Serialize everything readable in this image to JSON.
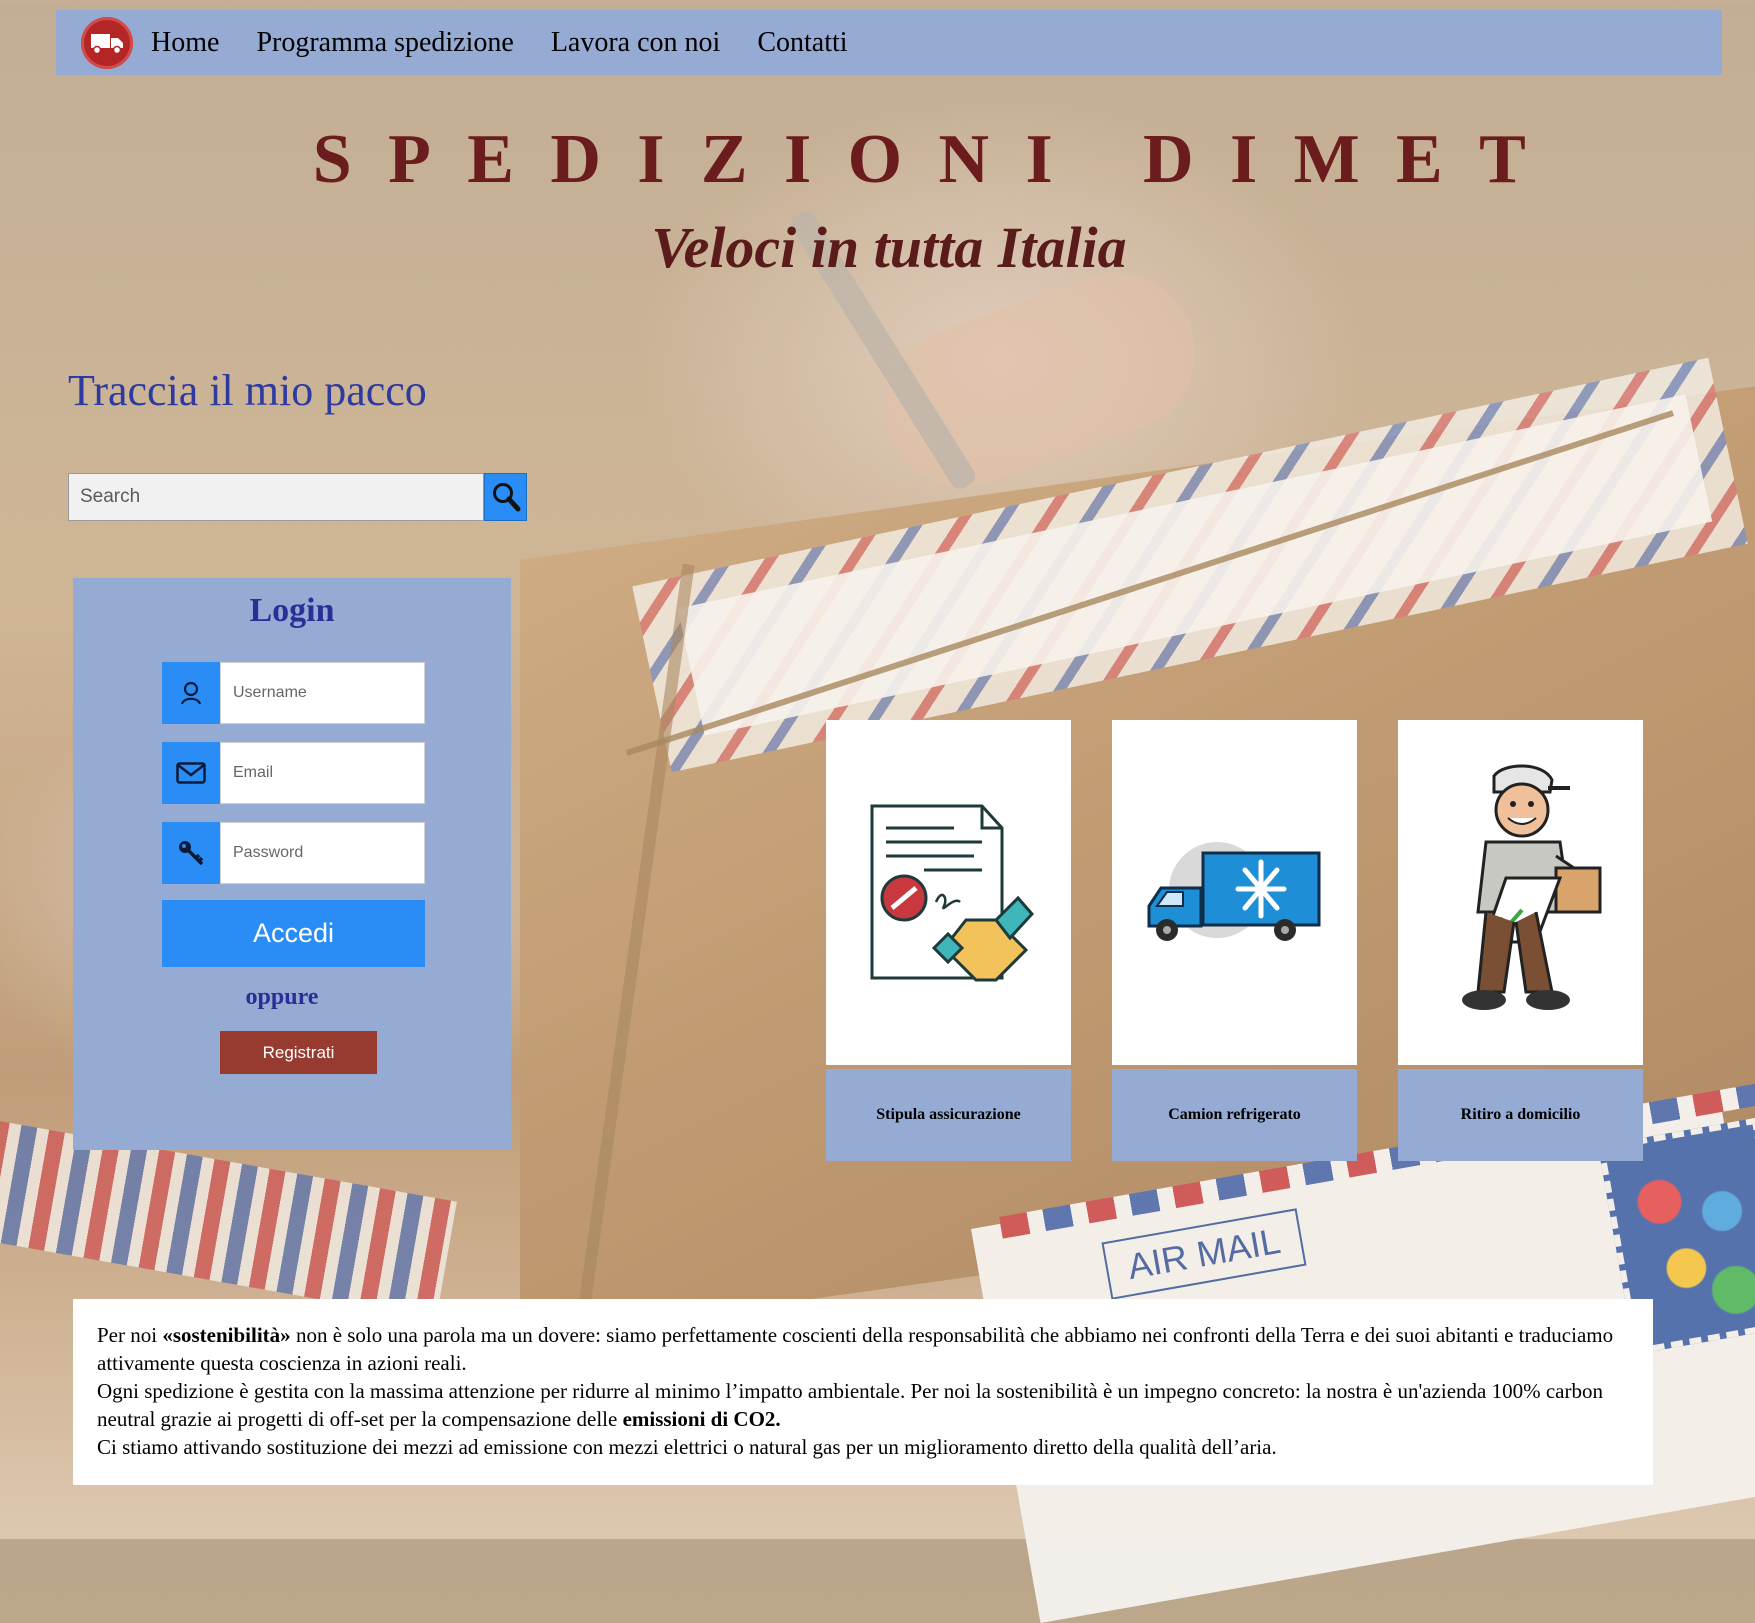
{
  "nav": {
    "links": [
      "Home",
      "Programma spedizione",
      "Lavora con noi",
      "Contatti"
    ]
  },
  "hero": {
    "title": "SPEDIZIONI DIMET",
    "tagline": "Veloci in tutta Italia"
  },
  "tracking": {
    "title": "Traccia il mio pacco",
    "search_placeholder": "Search"
  },
  "login": {
    "title": "Login",
    "username_placeholder": "Username",
    "email_placeholder": "Email",
    "password_placeholder": "Password",
    "submit_label": "Accedi",
    "or_label": "oppure",
    "register_label": "Registrati"
  },
  "services": [
    {
      "label": "Stipula assicurazione",
      "icon": "contract-handshake-icon"
    },
    {
      "label": "Camion refrigerato",
      "icon": "refrigerated-truck-icon"
    },
    {
      "label": "Ritiro a domicilio",
      "icon": "delivery-man-icon"
    }
  ],
  "background": {
    "airmail_text": "AIR MAIL"
  },
  "sustainability": {
    "p1_before": "Per noi ",
    "p1_bold": "«sostenibilità»",
    "p1_after": " non è solo una parola ma un dovere: siamo perfettamente coscienti della responsabilità che abbiamo nei confronti della Terra e dei suoi abitanti e traduciamo attivamente questa coscienza in azioni reali.",
    "p2_before": "Ogni spedizione è gestita con la massima attenzione per ridurre al minimo l’impatto ambientale. Per noi la sostenibilità è un impegno concreto: la nostra è un'azienda 100% carbon neutral grazie ai progetti di off-set per la compensazione delle ",
    "p2_bold": "emissioni di CO2.",
    "p3": "Ci stiamo attivando sostituzione dei mezzi ad emissione con mezzi elettrici o natural gas per un miglioramento diretto della qualità dell’aria."
  },
  "colors": {
    "nav_bg": "#95abd3",
    "brand_text": "#6b1d1d",
    "heading_blue": "#2a2e96",
    "button_blue": "#2a8df5",
    "register_red": "#973b31"
  }
}
